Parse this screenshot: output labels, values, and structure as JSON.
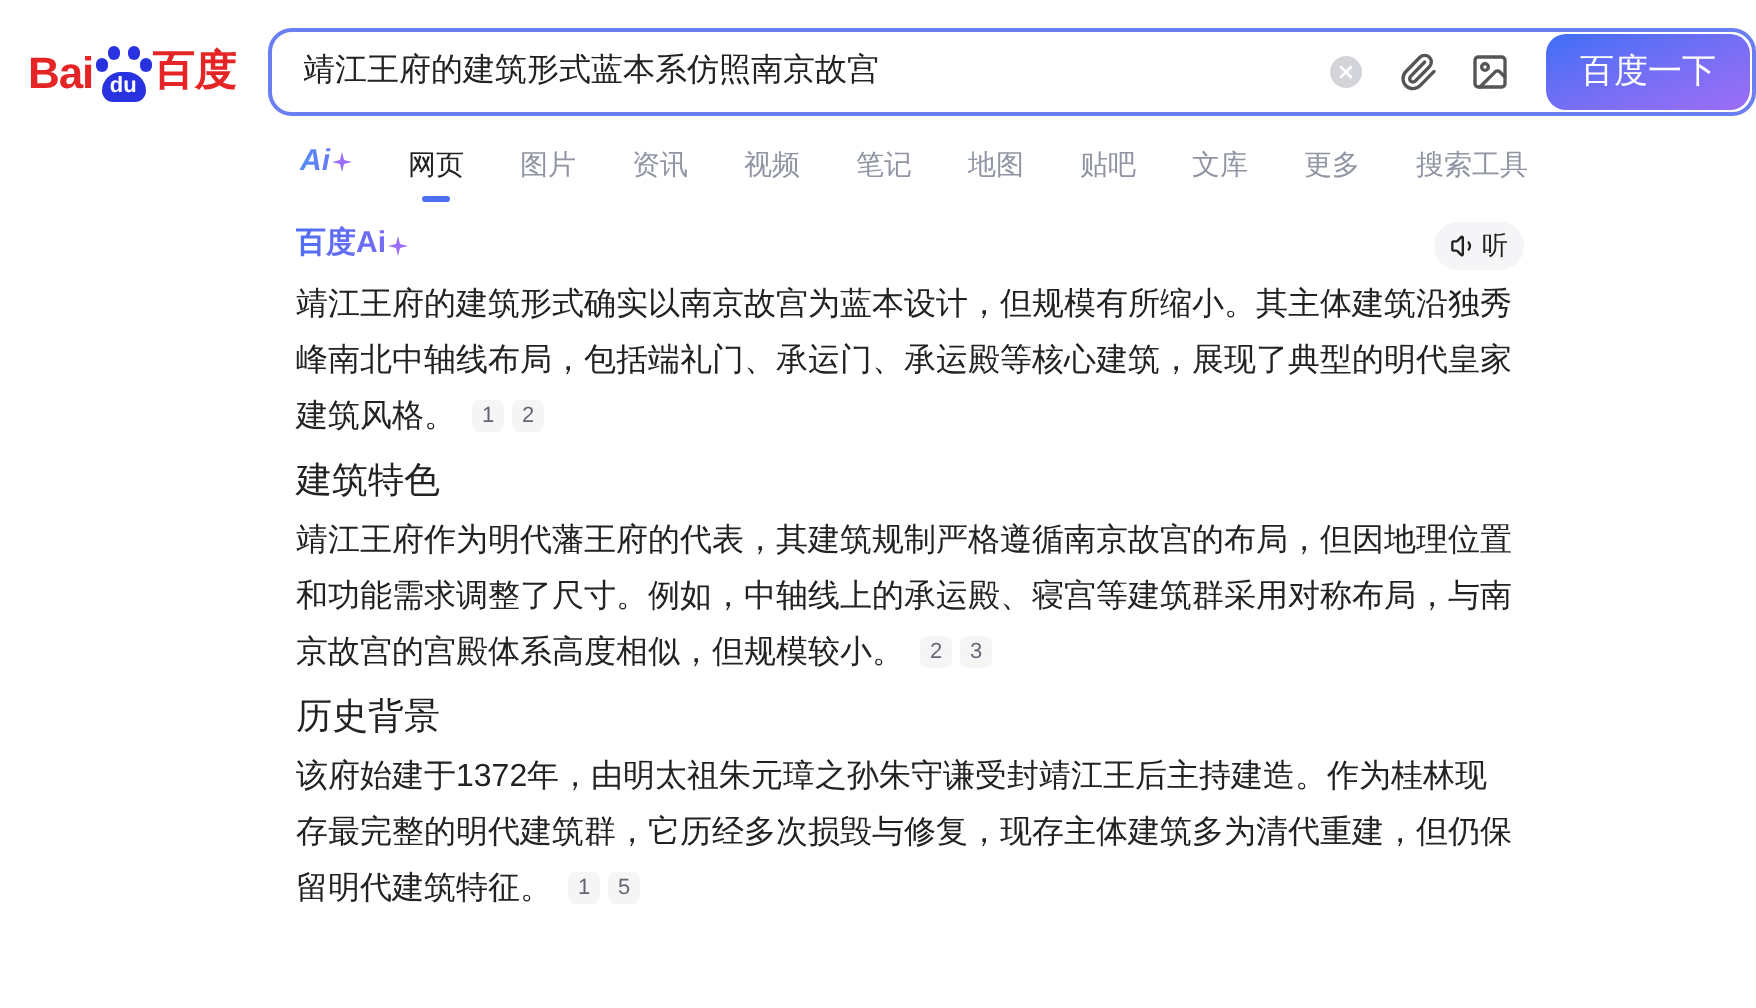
{
  "logo": {
    "left": "Bai",
    "paw": "du",
    "right": "百度"
  },
  "search": {
    "value": "靖江王府的建筑形式蓝本系仿照南京故宫",
    "button": "百度一下"
  },
  "tabs": [
    {
      "label": "Ai",
      "kind": "ai",
      "selected": false
    },
    {
      "label": "网页",
      "kind": "text",
      "selected": true
    },
    {
      "label": "图片",
      "kind": "text",
      "selected": false
    },
    {
      "label": "资讯",
      "kind": "text",
      "selected": false
    },
    {
      "label": "视频",
      "kind": "text",
      "selected": false
    },
    {
      "label": "笔记",
      "kind": "text",
      "selected": false
    },
    {
      "label": "地图",
      "kind": "text",
      "selected": false
    },
    {
      "label": "贴吧",
      "kind": "text",
      "selected": false
    },
    {
      "label": "文库",
      "kind": "text",
      "selected": false
    },
    {
      "label": "更多",
      "kind": "text",
      "selected": false
    },
    {
      "label": "搜索工具",
      "kind": "text",
      "selected": false
    }
  ],
  "answer": {
    "brand": "百度Ai",
    "listen": "听",
    "blocks": [
      {
        "kind": "paragraph",
        "text": "靖江王府的建筑形式确实以南京故宫为蓝本设计，但规模有所缩小。其主体建筑沿独秀峰南北中轴线布局，包括端礼门、承运门、承运殿等核心建筑，展现了典型的明代皇家建筑风格。",
        "citations": [
          "1",
          "2"
        ]
      },
      {
        "kind": "heading",
        "text": "建筑特色"
      },
      {
        "kind": "paragraph",
        "text": "靖江王府作为明代藩王府的代表，其建筑规制严格遵循南京故宫的布局，但因地理位置和功能需求调整了尺寸。例如，中轴线上的承运殿、寝宫等建筑群采用对称布局，与南京故宫的宫殿体系高度相似，但规模较小。",
        "citations": [
          "2",
          "3"
        ]
      },
      {
        "kind": "heading",
        "text": "历史背景"
      },
      {
        "kind": "paragraph",
        "text": "该府始建于1372年，由明太祖朱元璋之孙朱守谦受封靖江王后主持建造。作为桂林现存最完整的明代建筑群，它历经多次损毁与修复，现存主体建筑多为清代重建，但仍保留明代建筑特征。",
        "citations": [
          "1",
          "5"
        ]
      }
    ]
  }
}
